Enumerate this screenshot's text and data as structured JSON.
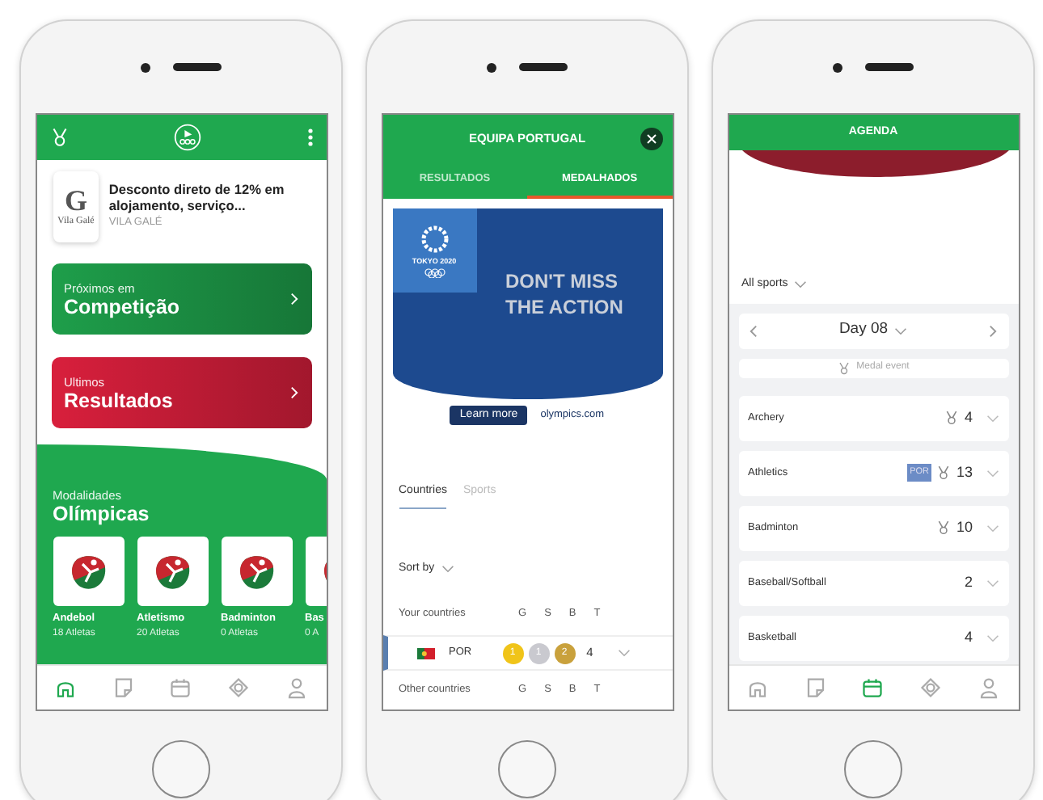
{
  "phones": [
    {
      "kind": "home",
      "promo": {
        "logo_letter": "G",
        "logo_text": "Vila Galé",
        "title": "Desconto direto de 12% em alojamento, serviço...",
        "subtitle": "VILA GALÉ"
      },
      "cards": [
        {
          "kicker": "Próximos em",
          "title": "Competição",
          "color": "#1e9e4a"
        },
        {
          "kicker": "Ultimos",
          "title": "Resultados",
          "color": "#d81f3c"
        }
      ],
      "sports_kicker": "Modalidades",
      "sports_title": "Olímpicas",
      "sports": [
        {
          "name": "Andebol",
          "athletes": "18 Atletas"
        },
        {
          "name": "Atletismo",
          "athletes": "20 Atletas"
        },
        {
          "name": "Badminton",
          "athletes": "0 Atletas"
        },
        {
          "name": "Bas",
          "athletes": "0 A"
        }
      ],
      "nav": [
        {
          "kind": "home",
          "selected": true
        },
        {
          "kind": "note",
          "selected": false
        },
        {
          "kind": "calendar",
          "selected": false
        },
        {
          "kind": "diamond",
          "selected": false
        },
        {
          "kind": "person",
          "selected": false
        }
      ]
    },
    {
      "kind": "medals",
      "title": "EQUIPA PORTUGAL",
      "tabs": [
        {
          "label": "RESULTADOS",
          "selected": false
        },
        {
          "label": "MEDALHADOS",
          "selected": true
        }
      ],
      "ad": {
        "emblem_text": "TOKYO 2020",
        "headline": "DON'T MISS THE ACTION",
        "button": "Learn more",
        "link": "olympics.com"
      },
      "subtabs": [
        {
          "label": "Countries",
          "selected": true
        },
        {
          "label": "Sports",
          "selected": false
        }
      ],
      "sort_label": "Sort by",
      "columns": [
        "G",
        "S",
        "B",
        "T"
      ],
      "group_1": "Your countries",
      "row": {
        "country": "POR",
        "medals": [
          {
            "kind": "gold",
            "count": "1"
          },
          {
            "kind": "silver",
            "count": "1"
          },
          {
            "kind": "bronze",
            "count": "2"
          }
        ],
        "total": "4"
      },
      "group_2": "Other countries",
      "columns_2": [
        "G",
        "S",
        "B",
        "T"
      ]
    },
    {
      "kind": "agenda",
      "title": "AGENDA",
      "filter": "All sports",
      "day": "Day 08",
      "medal_legend": "Medal event",
      "events": [
        {
          "sport": "Archery",
          "medal": true,
          "count": "4"
        },
        {
          "sport": "Athletics",
          "badge": "POR",
          "medal": true,
          "count": "13"
        },
        {
          "sport": "Badminton",
          "medal": true,
          "count": "10"
        },
        {
          "sport": "Baseball/Softball",
          "medal": false,
          "count": "2"
        },
        {
          "sport": "Basketball",
          "medal": false,
          "count": "4"
        }
      ],
      "nav": [
        {
          "kind": "home",
          "selected": false
        },
        {
          "kind": "note",
          "selected": false
        },
        {
          "kind": "calendar",
          "selected": true
        },
        {
          "kind": "diamond",
          "selected": false
        },
        {
          "kind": "person",
          "selected": false
        }
      ]
    }
  ]
}
